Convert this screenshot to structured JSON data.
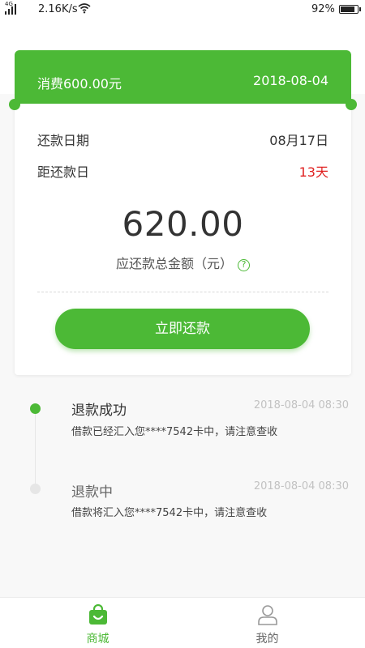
{
  "status_bar": {
    "network": "4G",
    "speed": "2.16K/s",
    "battery": "92%"
  },
  "header": {
    "consumption": "消费600.00元",
    "date": "2018-08-04"
  },
  "repayment": {
    "due_date_label": "还款日期",
    "due_date_value": "08月17日",
    "days_left_label": "距还款日",
    "days_left_value": "13天",
    "amount": "620.00",
    "amount_label": "应还款总金额（元）",
    "help_symbol": "?",
    "button_label": "立即还款"
  },
  "timeline": [
    {
      "title": "退款成功",
      "time": "2018-08-04 08:30",
      "desc": "借款已经汇入您****7542卡中，请注意查收",
      "active": true
    },
    {
      "title": "退款中",
      "time": "2018-08-04 08:30",
      "desc": "借款将汇入您****7542卡中，请注意查收",
      "active": false
    }
  ],
  "tabs": [
    {
      "label": "商城",
      "icon": "shopping-bag-icon",
      "active": true
    },
    {
      "label": "我的",
      "icon": "user-icon",
      "active": false
    }
  ],
  "colors": {
    "accent": "#4cb936",
    "warning": "#e02020",
    "muted": "#c2c2c2"
  }
}
